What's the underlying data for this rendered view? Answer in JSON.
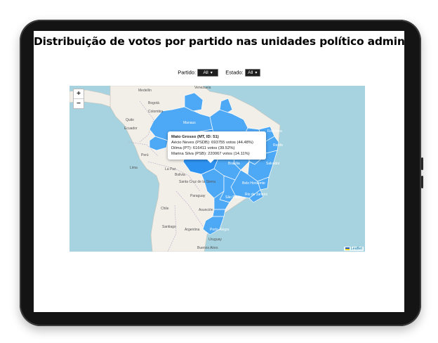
{
  "page": {
    "title": "Distribuição de votos por partido nas unidades político administrativas"
  },
  "controls": {
    "partido_label": "Partido:",
    "partido_value": "All",
    "estado_label": "Estado:",
    "estado_value": "All"
  },
  "map": {
    "zoom_in": "+",
    "zoom_out": "−",
    "attribution": "Leaflet",
    "ocean_color": "#a6d3df",
    "land_color": "#f2efe9",
    "state_fill_color": "#4da8f5",
    "selected_state_color": "#2e93f0",
    "place_labels": {
      "medellin": "Medellín",
      "bogota": "Bogotá",
      "venezuela": "Venezuela",
      "colombia": "Colombia",
      "quito": "Quito",
      "ecuador": "Ecuador",
      "manaus": "Manaus",
      "fortaleza": "Fortaleza",
      "recife": "Recife",
      "salvador": "Salvador",
      "peru": "Perú",
      "lima": "Lima",
      "la_paz": "La Paz",
      "bolivia": "Bolivia",
      "brasilia": "Brasília",
      "belo_horizonte": "Belo Horizonte",
      "rio": "Rio de Janeiro",
      "sao_paulo": "São Paulo",
      "santa_cruz": "Santa Cruz de la Sierra",
      "paraguay": "Paraguay",
      "asuncion": "Asunción",
      "porto_alegre": "Porto Alegre",
      "chile": "Chile",
      "santiago": "Santiago",
      "argentina": "Argentina",
      "uruguay": "Uruguay",
      "buenos_aires": "Buenos Aires"
    }
  },
  "popup": {
    "title": "Mato Grosso (MT, ID: 51)",
    "lines": [
      "Aécio Neves (PSDB): 693755 votos (44.48%)",
      "Dilma (PT): 616411 votos (39.52%)",
      "Marina Silva (PSB): 220067 votos (14.11%)"
    ]
  }
}
